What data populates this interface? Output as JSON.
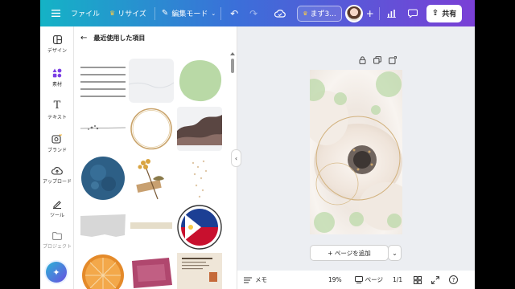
{
  "topbar": {
    "file_label": "ファイル",
    "resize_label": "リサイズ",
    "edit_mode_label": "編集モード",
    "project_label": "まず3...",
    "share_label": "共有"
  },
  "sidebar": {
    "items": [
      {
        "label": "デザイン",
        "icon": "layout-icon"
      },
      {
        "label": "素材",
        "icon": "elements-icon"
      },
      {
        "label": "テキスト",
        "icon": "text-icon"
      },
      {
        "label": "ブランド",
        "icon": "brand-icon"
      },
      {
        "label": "アップロード",
        "icon": "upload-icon"
      },
      {
        "label": "ツール",
        "icon": "draw-icon"
      },
      {
        "label": "プロジェクト",
        "icon": "folder-icon"
      }
    ]
  },
  "panel": {
    "title": "最近使用した項目"
  },
  "canvas": {
    "add_page_label": "+ ページを追加"
  },
  "bottombar": {
    "notes_label": "メモ",
    "zoom": "19%",
    "pages_label": "ページ",
    "page_count": "1/1"
  },
  "colors": {
    "gradient_start": "#14b3c6",
    "gradient_end": "#7a3fd6",
    "accent": "#6a4fe0"
  }
}
